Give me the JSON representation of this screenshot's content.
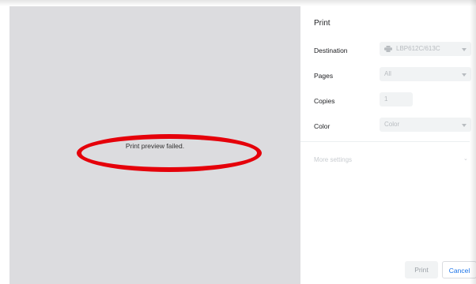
{
  "preview": {
    "message": "Print preview failed."
  },
  "panel": {
    "title": "Print",
    "destination": {
      "label": "Destination",
      "value": "LBP612C/613C",
      "icon": "printer-icon"
    },
    "pages": {
      "label": "Pages",
      "value": "All"
    },
    "copies": {
      "label": "Copies",
      "value": "1"
    },
    "color": {
      "label": "Color",
      "value": "Color"
    },
    "more_settings": "More settings"
  },
  "buttons": {
    "print": "Print",
    "cancel": "Cancel"
  },
  "colors": {
    "preview_bg": "#dcdcdf",
    "annotation": "#e5000a",
    "accent": "#1a73e8"
  }
}
